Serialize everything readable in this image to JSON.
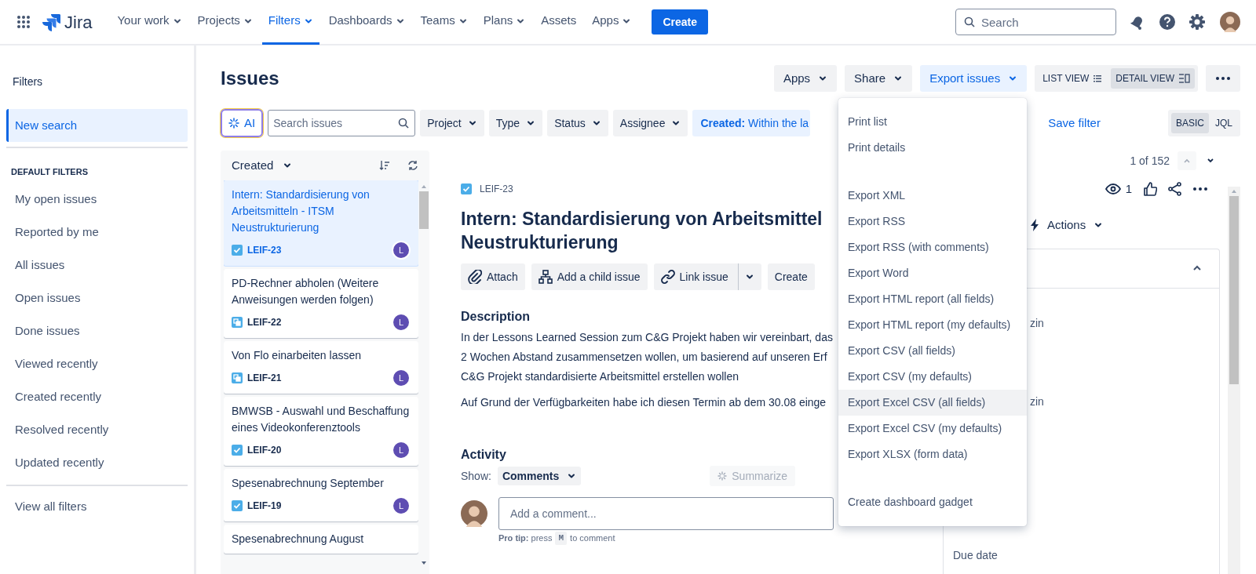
{
  "nav": {
    "product": "Jira",
    "items": [
      {
        "label": "Your work",
        "dropdown": true,
        "selected": false
      },
      {
        "label": "Projects",
        "dropdown": true,
        "selected": false
      },
      {
        "label": "Filters",
        "dropdown": true,
        "selected": true
      },
      {
        "label": "Dashboards",
        "dropdown": true,
        "selected": false
      },
      {
        "label": "Teams",
        "dropdown": true,
        "selected": false
      },
      {
        "label": "Plans",
        "dropdown": true,
        "selected": false
      },
      {
        "label": "Assets",
        "dropdown": false,
        "selected": false
      },
      {
        "label": "Apps",
        "dropdown": true,
        "selected": false
      }
    ],
    "create": "Create",
    "search": {
      "placeholder": "Search"
    }
  },
  "sidebar": {
    "title": "Filters",
    "top_items": [
      {
        "label": "New search",
        "selected": true
      }
    ],
    "section": "DEFAULT FILTERS",
    "items": [
      {
        "label": "My open issues",
        "selected": false
      },
      {
        "label": "Reported by me",
        "selected": false
      },
      {
        "label": "All issues",
        "selected": false
      },
      {
        "label": "Open issues",
        "selected": false
      },
      {
        "label": "Done issues",
        "selected": false
      },
      {
        "label": "Viewed recently",
        "selected": false
      },
      {
        "label": "Created recently",
        "selected": false
      },
      {
        "label": "Resolved recently",
        "selected": false
      },
      {
        "label": "Updated recently",
        "selected": false
      }
    ],
    "footer": "View all filters"
  },
  "header": {
    "title": "Issues",
    "buttons": [
      {
        "label": "Apps",
        "selected": false
      },
      {
        "label": "Share",
        "selected": false
      },
      {
        "label": "Export issues",
        "selected": true
      }
    ],
    "views": [
      {
        "label": "LIST VIEW",
        "kind": "list",
        "selected": false
      },
      {
        "label": "DETAIL VIEW",
        "kind": "detail",
        "selected": true
      }
    ]
  },
  "filters": {
    "ai": "AI",
    "search": {
      "placeholder": "Search issues"
    },
    "dropdowns": [
      "Project",
      "Type",
      "Status",
      "Assignee"
    ],
    "chip": "**Created:** Within the la",
    "save": "Save filter",
    "modes": [
      {
        "label": "BASIC",
        "selected": true
      },
      {
        "label": "JQL",
        "selected": false
      }
    ]
  },
  "list": {
    "sort": "Created",
    "cards": [
      {
        "title": "Intern: Standardisierung von Arbeitsmitteln - ITSM Neustrukturierung",
        "key": "LEIF-23",
        "kind": "task",
        "assignee": "L",
        "selected": true
      },
      {
        "title": "PD-Rechner abholen (Weitere Anweisungen werden folgen)",
        "key": "LEIF-22",
        "kind": "subtask",
        "assignee": "L",
        "selected": false
      },
      {
        "title": "Von Flo einarbeiten lassen",
        "key": "LEIF-21",
        "kind": "subtask",
        "assignee": "L",
        "selected": false
      },
      {
        "title": "BMWSB - Auswahl und Beschaffung eines Videokonferenztools",
        "key": "LEIF-20",
        "kind": "task",
        "assignee": "L",
        "selected": false
      },
      {
        "title": "Spesenabrechnung September",
        "key": "LEIF-19",
        "kind": "task",
        "assignee": "L",
        "selected": false
      },
      {
        "title": "Spesenabrechnung August",
        "selected": false
      }
    ]
  },
  "detail": {
    "key": "LEIF-23",
    "title_lines": [
      "Intern: Standardisierung von Arbeitsmittel",
      "Neustrukturierung"
    ],
    "actions": [
      {
        "label": "Attach",
        "kind": "attach"
      },
      {
        "label": "Add a child issue",
        "kind": "child"
      },
      {
        "label": "Link issue",
        "kind": "link"
      },
      {
        "label": "Create",
        "kind": "plain"
      }
    ],
    "description_heading": "Description",
    "description_lines": [
      "In der Lessons Learned Session zum C&G Projekt haben wir vereinbart, das",
      "2 Wochen Abstand zusammensetzen wollen, um basierend auf unseren Erf",
      "C&G Projekt standardisierte Arbeitsmittel erstellen wollen"
    ],
    "description_note": "Auf Grund der Verfügbarkeiten habe ich diesen Termin ab dem 30.08 einge",
    "activity": "Activity",
    "show_label": "Show:",
    "show_value": "Comments",
    "summarize": "Summarize",
    "comment": {
      "placeholder": "Add a comment..."
    },
    "tip": "**Pro tip:** press",
    "tip_key": "M",
    "tip_end": "to comment"
  },
  "side": {
    "pager": "1 of 152",
    "watchers": "1",
    "actions": "Actions",
    "fields": [
      "zin",
      "zin",
      "Due date"
    ]
  },
  "menu": {
    "groups": [
      [
        {
          "label": "Print list",
          "highlighted": false
        },
        {
          "label": "Print details",
          "highlighted": false
        }
      ],
      [
        {
          "label": "Export XML",
          "highlighted": false
        },
        {
          "label": "Export RSS",
          "highlighted": false
        },
        {
          "label": "Export RSS (with comments)",
          "highlighted": false
        },
        {
          "label": "Export Word",
          "highlighted": false
        },
        {
          "label": "Export HTML report (all fields)",
          "highlighted": false
        },
        {
          "label": "Export HTML report (my defaults)",
          "highlighted": false
        },
        {
          "label": "Export CSV (all fields)",
          "highlighted": false
        },
        {
          "label": "Export CSV (my defaults)",
          "highlighted": false
        },
        {
          "label": "Export Excel CSV (all fields)",
          "highlighted": true
        },
        {
          "label": "Export Excel CSV (my defaults)",
          "highlighted": false
        },
        {
          "label": "Export XLSX (form data)",
          "highlighted": false
        }
      ],
      [
        {
          "label": "Create dashboard gadget",
          "highlighted": false
        }
      ]
    ]
  }
}
